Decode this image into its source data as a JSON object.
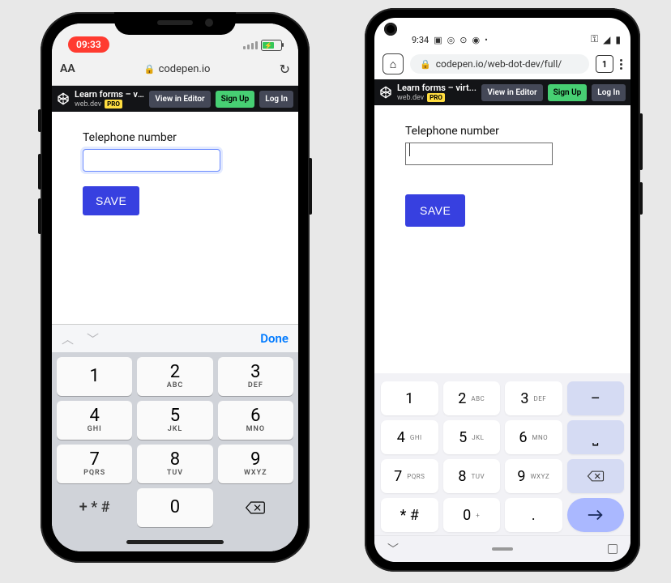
{
  "ios": {
    "status": {
      "time": "09:33"
    },
    "safari": {
      "aa": "AA",
      "host": "codepen.io"
    },
    "codepen": {
      "title": "Learn forms – virt...",
      "author": "web.dev",
      "pro": "PRO",
      "view": "View in Editor",
      "signup": "Sign Up",
      "login": "Log In"
    },
    "form": {
      "label": "Telephone number",
      "save": "SAVE"
    },
    "acc": {
      "done": "Done"
    },
    "keypad": {
      "k1": {
        "n": "1",
        "l": ""
      },
      "k2": {
        "n": "2",
        "l": "ABC"
      },
      "k3": {
        "n": "3",
        "l": "DEF"
      },
      "k4": {
        "n": "4",
        "l": "GHI"
      },
      "k5": {
        "n": "5",
        "l": "JKL"
      },
      "k6": {
        "n": "6",
        "l": "MNO"
      },
      "k7": {
        "n": "7",
        "l": "PQRS"
      },
      "k8": {
        "n": "8",
        "l": "TUV"
      },
      "k9": {
        "n": "9",
        "l": "WXYZ"
      },
      "sym": "+ * #",
      "k0": {
        "n": "0",
        "l": ""
      }
    }
  },
  "android": {
    "status": {
      "time": "9:34"
    },
    "chrome": {
      "url": "codepen.io/web-dot-dev/full/",
      "tabs": "1"
    },
    "codepen": {
      "title": "Learn forms – virt...",
      "author": "web.dev",
      "pro": "PRO",
      "view": "View in Editor",
      "signup": "Sign Up",
      "login": "Log In"
    },
    "form": {
      "label": "Telephone number",
      "save": "SAVE"
    },
    "keypad": {
      "k1": {
        "n": "1",
        "l": ""
      },
      "k2": {
        "n": "2",
        "l": "ABC"
      },
      "k3": {
        "n": "3",
        "l": "DEF"
      },
      "dash": "–",
      "k4": {
        "n": "4",
        "l": "GHI"
      },
      "k5": {
        "n": "5",
        "l": "JKL"
      },
      "k6": {
        "n": "6",
        "l": "MNO"
      },
      "space": "⎵",
      "k7": {
        "n": "7",
        "l": "PQRS"
      },
      "k8": {
        "n": "8",
        "l": "TUV"
      },
      "k9": {
        "n": "9",
        "l": "WXYZ"
      },
      "starhash": "* #",
      "k0": {
        "n": "0",
        "l": "+"
      },
      "dot": "."
    }
  }
}
